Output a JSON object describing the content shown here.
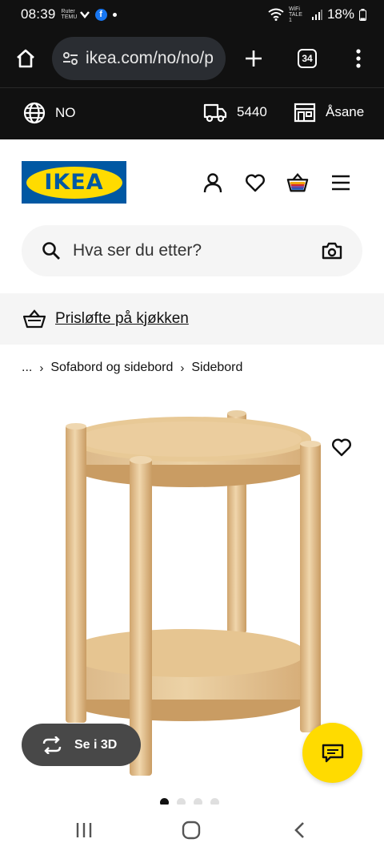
{
  "status_bar": {
    "time": "08:39",
    "mini_label": "Ruter TEMU",
    "wifi_label": "WiFi TALE 1",
    "battery": "18%"
  },
  "browser": {
    "url": "ikea.com/no/no/p",
    "tab_count": "34"
  },
  "top_bar": {
    "country": "NO",
    "postcode": "5440",
    "store": "Åsane"
  },
  "brand": {
    "logo_text": "IKEA",
    "primary_blue": "#0058a3",
    "primary_yellow": "#ffdb00"
  },
  "search": {
    "placeholder": "Hva ser du etter?"
  },
  "promo": {
    "text": "Prisløfte på kjøkken"
  },
  "breadcrumb": {
    "ellipsis": "...",
    "items": [
      "Sofabord og sidebord",
      "Sidebord"
    ]
  },
  "product": {
    "see_3d_label": "Se i 3D",
    "image_count": 4,
    "active_image": 0
  },
  "icons": {
    "home": "home-icon",
    "tune": "site-settings-icon",
    "add": "new-tab-icon",
    "menu": "overflow-menu-icon",
    "globe": "globe-icon",
    "truck": "delivery-truck-icon",
    "store": "store-icon",
    "profile": "profile-icon",
    "heart": "heart-icon",
    "basket": "shopping-bag-icon",
    "hamburger": "hamburger-menu-icon",
    "search": "search-icon",
    "camera": "camera-search-icon",
    "chat": "chat-icon"
  }
}
